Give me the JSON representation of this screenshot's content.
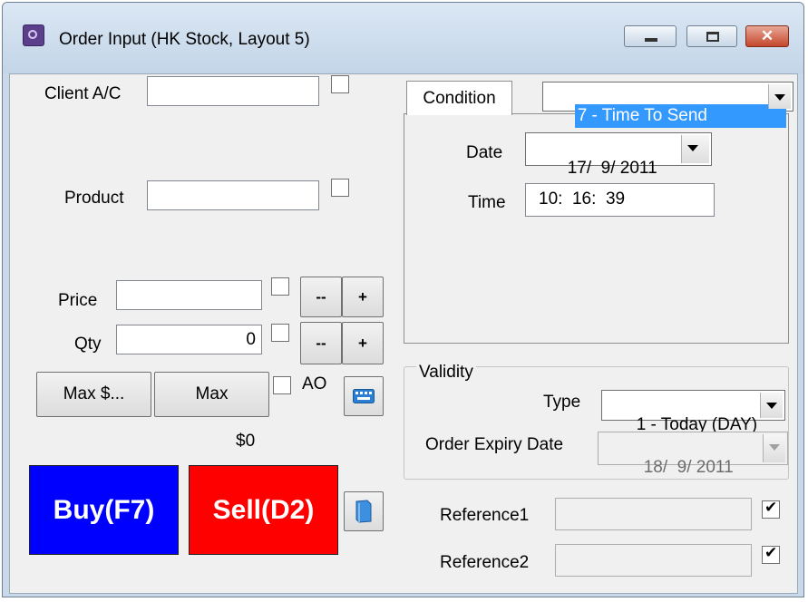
{
  "window": {
    "title": "Order Input (HK Stock, Layout 5)",
    "close_glyph": "✕"
  },
  "left": {
    "client_ac_label": "Client A/C",
    "client_ac_value": "",
    "product_label": "Product",
    "product_value": "",
    "price_label": "Price",
    "price_value": "",
    "qty_label": "Qty",
    "qty_value": "0",
    "price_minus": "--",
    "price_plus": "+",
    "qty_minus": "--",
    "qty_plus": "+",
    "max_amount_button": "Max $...",
    "max_button": "Max",
    "ao_label": "AO",
    "total_amount": "$0",
    "buy_button": "Buy(F7)",
    "sell_button": "Sell(D2)"
  },
  "condition": {
    "tab_label": "Condition",
    "type_selected": "7 - Time To Send",
    "date_label": "Date",
    "date_value": "17/  9/ 2011",
    "time_label": "Time",
    "time_value": "10:  16:  39"
  },
  "validity": {
    "group_label": "Validity",
    "type_label": "Type",
    "type_selected": "1 - Today (DAY)",
    "expiry_label": "Order Expiry Date",
    "expiry_value": "18/  9/ 2011"
  },
  "references": {
    "reference1_label": "Reference1",
    "reference1_value": "",
    "reference1_checked": true,
    "reference2_label": "Reference2",
    "reference2_value": "",
    "reference2_checked": true
  },
  "colors": {
    "buy": "#0000ff",
    "sell": "#ff0000",
    "selection": "#3399ff"
  }
}
